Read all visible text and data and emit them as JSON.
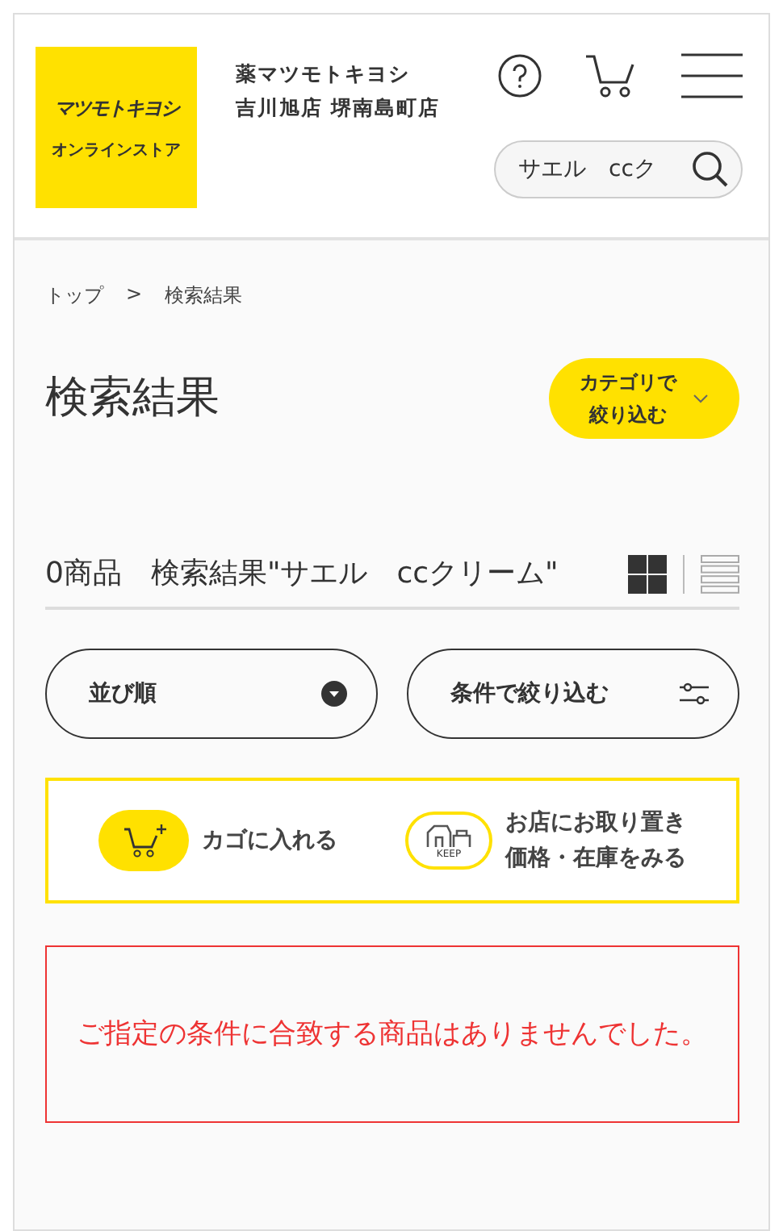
{
  "header": {
    "logo": {
      "brand": "マツモトキヨシ",
      "sub": "オンラインストア"
    },
    "store": {
      "name": "薬マツモトキヨシ",
      "branch": "吉川旭店 堺南島町店"
    },
    "search": {
      "value": "サエル　ccク"
    }
  },
  "breadcrumb": [
    {
      "label": "トップ"
    },
    {
      "label": ">"
    },
    {
      "label": "検索結果"
    }
  ],
  "title": "検索結果",
  "category_button": {
    "lines": [
      "カテゴリで",
      "絞り込む"
    ]
  },
  "result_summary": "0商品　検索結果\"サエル　ccクリーム\"",
  "view_modes": [
    {
      "kind": "grid",
      "selected": true
    },
    {
      "kind": "list",
      "selected": false
    }
  ],
  "sort_button": {
    "label": "並び順"
  },
  "filter_button": {
    "label": "条件で絞り込む"
  },
  "legend": [
    {
      "kind": "cart",
      "lines": [
        "カゴに入れる"
      ]
    },
    {
      "kind": "keep",
      "badge": "KEEP",
      "lines": [
        "お店にお取り置き",
        "価格・在庫をみる"
      ]
    }
  ],
  "message": "ご指定の条件に合致する商品はありませんでした。"
}
